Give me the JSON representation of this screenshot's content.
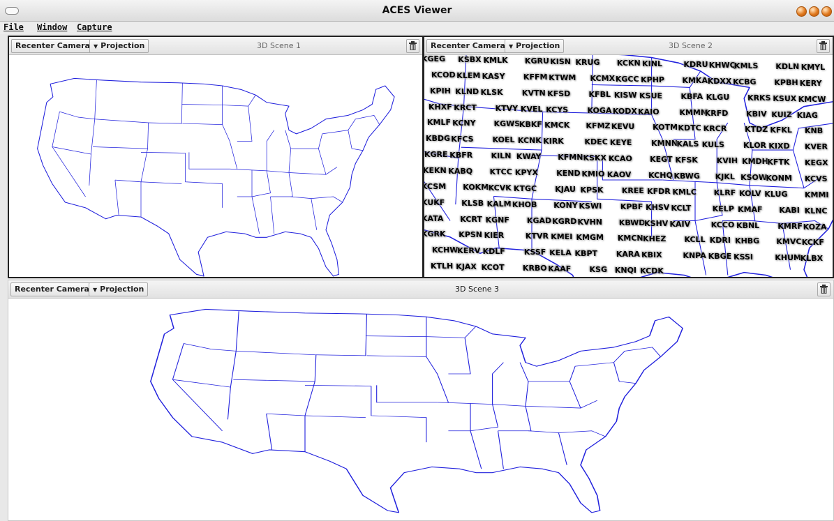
{
  "window": {
    "title": "ACES Viewer"
  },
  "menu": [
    {
      "label": "File"
    },
    {
      "label": "Window"
    },
    {
      "label": "Capture"
    }
  ],
  "scenes": [
    {
      "title": "3D Scene 1",
      "recenter": "Recenter Camera",
      "projection": "Projection",
      "map_style": "outline"
    },
    {
      "title": "3D Scene 2",
      "recenter": "Recenter Camera",
      "projection": "Projection",
      "map_style": "zoomed-with-stations"
    },
    {
      "title": "3D Scene 3",
      "recenter": "Recenter Camera",
      "projection": "Projection",
      "map_style": "outline"
    }
  ],
  "colors": {
    "map_line": "#2222dd",
    "station_text": "#000000",
    "station_shadow": "#9a9a9a"
  },
  "icons": {
    "trash": "trash-icon",
    "dropdown": "dropdown-arrow-icon",
    "window_controls": "window-control-icon"
  },
  "stations": [
    "KGEG",
    "KSBX",
    "KMLK",
    "KGRU",
    "KISN",
    "KRUG",
    "KCKN",
    "KINL",
    "KDRU",
    "KHWQ",
    "KMLS",
    "KDLN",
    "KMYL",
    "KCOD",
    "KLEM",
    "KASY",
    "KFFM",
    "KTWM",
    "KCMX",
    "KGCC",
    "KPHP",
    "KMKA",
    "KDXX",
    "KCBG",
    "KPBH",
    "KERY",
    "KPIH",
    "KLND",
    "KLSK",
    "KVTN",
    "KFSD",
    "KFBL",
    "KISW",
    "KSUE",
    "KBFA",
    "KLGU",
    "KRKS",
    "KSUX",
    "KMCW",
    "KHXF",
    "KRCT",
    "KTVY",
    "KVEL",
    "KCYS",
    "KOGA",
    "KODX",
    "KAIO",
    "KMMM",
    "KRFD",
    "KBIV",
    "KUIZ",
    "KIAG",
    "KMLF",
    "KCNY",
    "KGWS",
    "KBKF",
    "KMCK",
    "KFMZ",
    "KEVU",
    "KOTM",
    "KDTC",
    "KRCR",
    "KTDZ",
    "KFKL",
    "KNB",
    "KBDG",
    "KFCS",
    "KOEL",
    "KCNK",
    "KIRK",
    "KDEC",
    "KEYE",
    "KMNN",
    "KALS",
    "KULS",
    "KLOR",
    "KIXD",
    "KVER",
    "KGRE",
    "KBFR",
    "KILN",
    "KWAY",
    "KFMN",
    "KSKX",
    "KCAO",
    "KEGT",
    "KFSK",
    "KVIH",
    "KMDH",
    "KFTK",
    "KEGX",
    "KEKN",
    "KABQ",
    "KTCC",
    "KPYX",
    "KEND",
    "KMIO",
    "KAOV",
    "KCHQ",
    "KBWG",
    "KJKL",
    "KSOW",
    "KONM",
    "KCVS",
    "KCSM",
    "KOKM",
    "KCVK",
    "KTGC",
    "KJAU",
    "KPSK",
    "KREE",
    "KFDR",
    "KMLC",
    "KLRF",
    "KOLV",
    "KLUG",
    "KMMI",
    "KUKF",
    "KLSB",
    "KALM",
    "KHOB",
    "KONY",
    "KSWI",
    "KPBF",
    "KHSV",
    "KCLT",
    "KELP",
    "KMAF",
    "KABI",
    "KLNC",
    "KATA",
    "KCRT",
    "KGNF",
    "KGAD",
    "KGRD",
    "KVHN",
    "KBWD",
    "KSHV",
    "KAIV",
    "KCCO",
    "KBNL",
    "KMRF",
    "KOZA",
    "KGRK",
    "KPSN",
    "KIER",
    "KTVR",
    "KMEI",
    "KMGM",
    "KMCN",
    "KHEZ",
    "KCLL",
    "KDRI",
    "KHBG",
    "KMVC",
    "KCKF",
    "KCHW",
    "KERV",
    "KDLF",
    "KSSF",
    "KELA",
    "KBPT",
    "KARA",
    "KBIX",
    "KNPA",
    "KBGE",
    "KSSI",
    "KHUM",
    "KLBX",
    "KTLH",
    "KJAX",
    "KCOT",
    "KRBO",
    "KAAF",
    "KSG",
    "KNQI",
    "KCDK"
  ]
}
